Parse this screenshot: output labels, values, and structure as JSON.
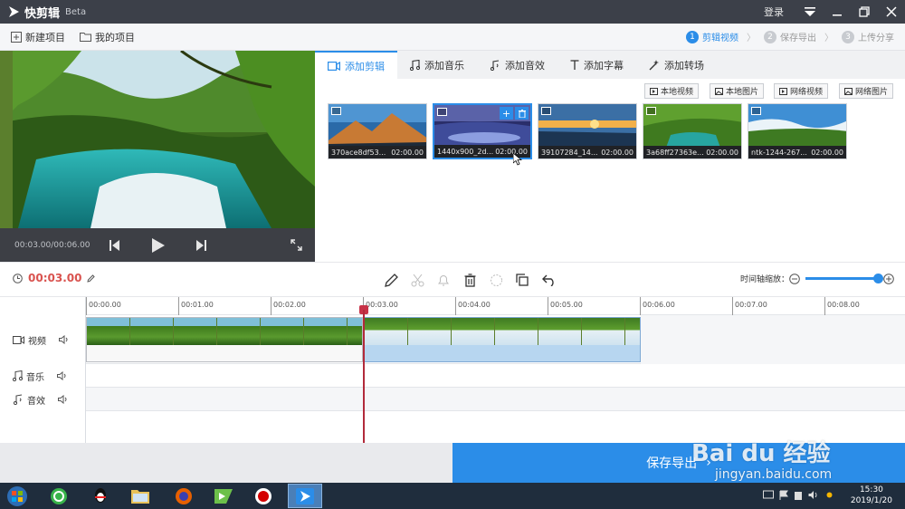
{
  "titlebar": {
    "app_name": "快剪辑",
    "beta": "Beta",
    "login": "登录"
  },
  "menubar": {
    "new_project": "新建项目",
    "my_projects": "我的项目",
    "steps": [
      {
        "num": "1",
        "label": "剪辑视频",
        "active": true
      },
      {
        "num": "2",
        "label": "保存导出",
        "active": false
      },
      {
        "num": "3",
        "label": "上传分享",
        "active": false
      }
    ]
  },
  "preview": {
    "time": "00:03.00/00:06.00"
  },
  "tabs": [
    {
      "label": "添加剪辑",
      "active": true
    },
    {
      "label": "添加音乐",
      "active": false
    },
    {
      "label": "添加音效",
      "active": false
    },
    {
      "label": "添加字幕",
      "active": false
    },
    {
      "label": "添加转场",
      "active": false
    }
  ],
  "sources": [
    "本地视频",
    "本地图片",
    "网络视频",
    "网络图片"
  ],
  "thumbs": [
    {
      "name": "370ace8df53...",
      "duration": "02:00.00"
    },
    {
      "name": "1440x900_2d...",
      "duration": "02:00.00"
    },
    {
      "name": "39107284_14...",
      "duration": "02:00.00"
    },
    {
      "name": "3a68ff27363e...",
      "duration": "02:00.00"
    },
    {
      "name": "ntk-1244-267...",
      "duration": "02:00.00"
    }
  ],
  "thumb_tools": {
    "add": "+",
    "delete": "🗑"
  },
  "editbar": {
    "current_time": "00:03.00",
    "zoom_label": "时间轴缩放：",
    "zoom_level": 0.85
  },
  "ruler": [
    "00:00.00",
    "00:01.00",
    "00:02.00",
    "00:03.00",
    "00:04.00",
    "00:05.00",
    "00:06.00",
    "00:07.00",
    "00:08.00"
  ],
  "tracks": {
    "video": "视频",
    "music": "音乐",
    "sound": "音效"
  },
  "export": {
    "label": "保存导出",
    "chevron": "›"
  },
  "watermark": {
    "brand": "Bai du 经验",
    "url": "jingyan.baidu.com"
  },
  "taskbar": {
    "time": "15:30",
    "date": "2019/1/20"
  },
  "colors": {
    "accent": "#2b8de8",
    "titlebar": "#3c4049",
    "playhead": "#b22a3b"
  }
}
